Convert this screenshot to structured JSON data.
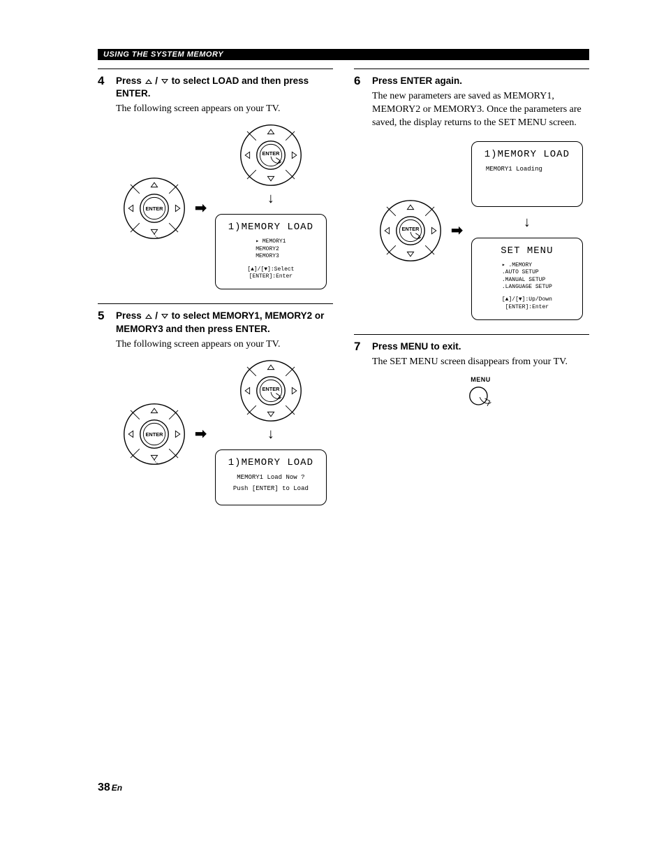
{
  "header": "USING THE SYSTEM MEMORY",
  "steps": {
    "s4": {
      "num": "4",
      "title_a": "Press ",
      "title_b": " / ",
      "title_c": " to select LOAD and then press ENTER.",
      "text": "The following screen appears on your TV."
    },
    "s5": {
      "num": "5",
      "title_a": "Press ",
      "title_b": " / ",
      "title_c": " to select MEMORY1, MEMORY2 or MEMORY3 and then press ENTER.",
      "text": "The following screen appears on your TV."
    },
    "s6": {
      "num": "6",
      "title": "Press ENTER again.",
      "text": "The new parameters are saved as MEMORY1, MEMORY2 or MEMORY3. Once the parameters are saved, the display returns to the SET MENU screen."
    },
    "s7": {
      "num": "7",
      "title": "Press MENU to exit.",
      "text": "The SET MENU screen disappears from your TV."
    }
  },
  "enter": "ENTER",
  "menu": "MENU",
  "screens": {
    "load_list": {
      "title": "1)MEMORY LOAD",
      "items": [
        "▸ MEMORY1",
        "  MEMORY2",
        "  MEMORY3"
      ],
      "hint1": "[▲]/[▼]:Select",
      "hint2": "[ENTER]:Enter"
    },
    "load_confirm": {
      "title": "1)MEMORY LOAD",
      "line1": "MEMORY1 Load Now ?",
      "line2": "Push [ENTER] to Load"
    },
    "loading": {
      "title": "1)MEMORY LOAD",
      "line": "MEMORY1 Loading"
    },
    "set_menu": {
      "title": "SET MENU",
      "items": [
        "▸ .MEMORY",
        "  .AUTO SETUP",
        "  .MANUAL SETUP",
        "  .LANGUAGE SETUP"
      ],
      "hint1": "[▲]/[▼]:Up/Down",
      "hint2": "[ENTER]:Enter"
    }
  },
  "page_number": "38",
  "page_lang": "En"
}
